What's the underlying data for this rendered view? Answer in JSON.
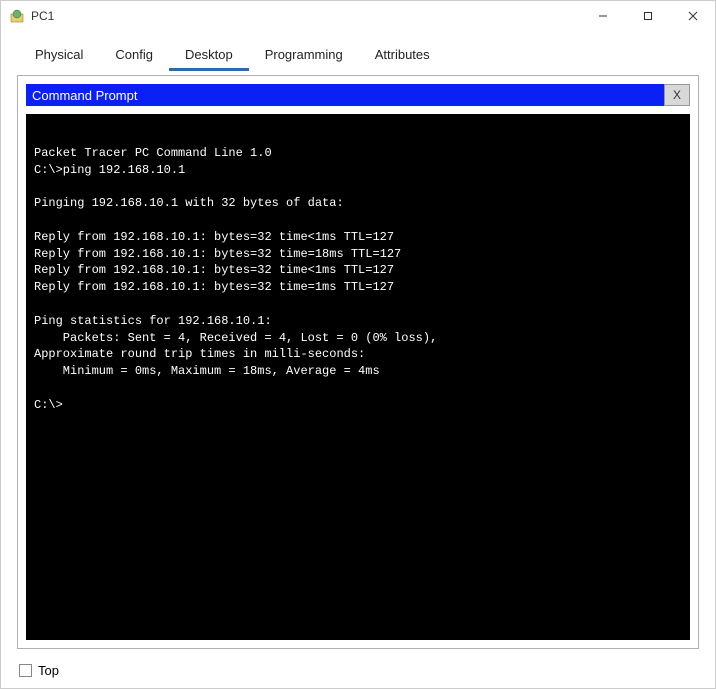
{
  "window": {
    "title": "PC1"
  },
  "tabs": [
    {
      "label": "Physical",
      "active": false
    },
    {
      "label": "Config",
      "active": false
    },
    {
      "label": "Desktop",
      "active": true
    },
    {
      "label": "Programming",
      "active": false
    },
    {
      "label": "Attributes",
      "active": false
    }
  ],
  "command_prompt": {
    "title": "Command Prompt",
    "close_label": "X"
  },
  "terminal": {
    "lines": [
      "",
      "Packet Tracer PC Command Line 1.0",
      "C:\\>ping 192.168.10.1",
      "",
      "Pinging 192.168.10.1 with 32 bytes of data:",
      "",
      "Reply from 192.168.10.1: bytes=32 time<1ms TTL=127",
      "Reply from 192.168.10.1: bytes=32 time=18ms TTL=127",
      "Reply from 192.168.10.1: bytes=32 time<1ms TTL=127",
      "Reply from 192.168.10.1: bytes=32 time=1ms TTL=127",
      "",
      "Ping statistics for 192.168.10.1:",
      "    Packets: Sent = 4, Received = 4, Lost = 0 (0% loss),",
      "Approximate round trip times in milli-seconds:",
      "    Minimum = 0ms, Maximum = 18ms, Average = 4ms",
      "",
      "C:\\>"
    ]
  },
  "footer": {
    "top_label": "Top",
    "top_checked": false
  }
}
